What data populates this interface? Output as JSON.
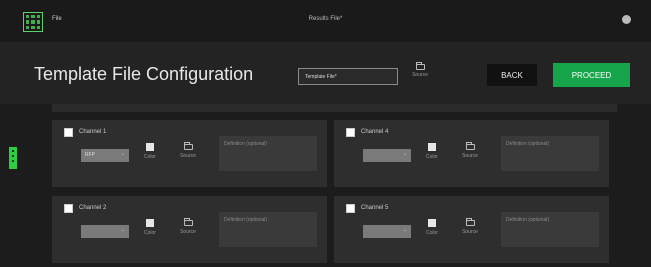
{
  "topbar": {
    "menu_file": "File",
    "center_title": "Results File*",
    "logo_icon": "grid-logo-icon",
    "globe_icon": "globe-icon"
  },
  "header": {
    "title": "Template File Configuration",
    "template_input_value": "Template File*",
    "source_label": "Source",
    "back_label": "BACK",
    "proceed_label": "PROCEED"
  },
  "colors": {
    "accent": "#16a54a",
    "background": "#1e1e1e",
    "panel": "#2e2e2e"
  },
  "channels": [
    {
      "label": "Channel 1",
      "select_value": "RFP",
      "color_label": "Color",
      "source_label": "Source",
      "definition_placeholder": "Definition (optional)"
    },
    {
      "label": "Channel 4",
      "select_value": "",
      "color_label": "Color",
      "source_label": "Source",
      "definition_placeholder": "Definition (optional)"
    },
    {
      "label": "Channel 2",
      "select_value": "",
      "color_label": "Color",
      "source_label": "Source",
      "definition_placeholder": "Definition (optional)"
    },
    {
      "label": "Channel 5",
      "select_value": "",
      "color_label": "Color",
      "source_label": "Source",
      "definition_placeholder": "Definition (optional)"
    }
  ]
}
